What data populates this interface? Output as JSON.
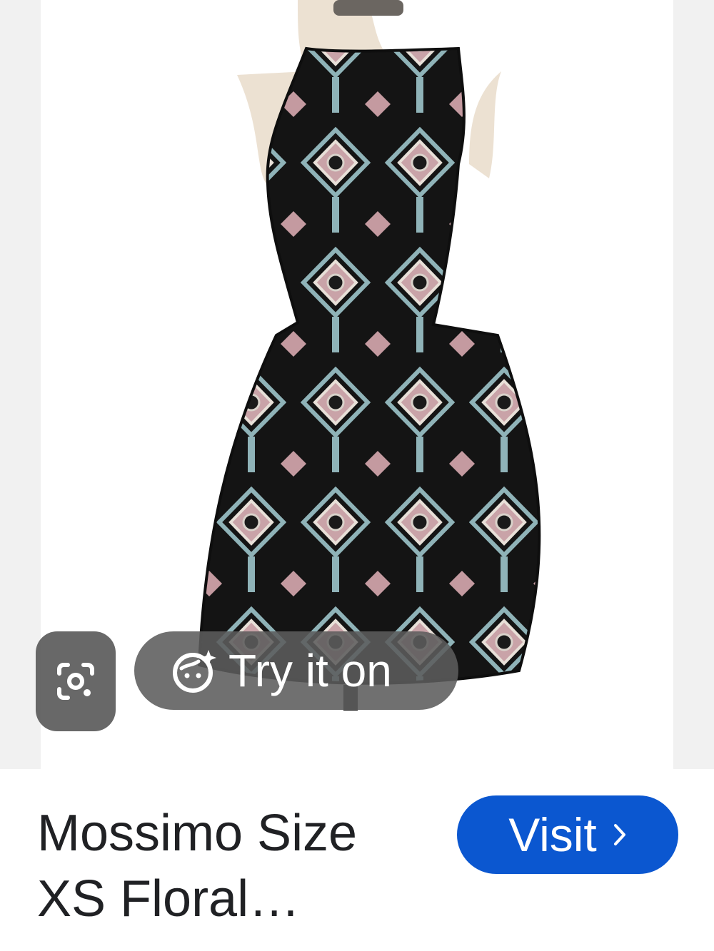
{
  "image_viewer": {
    "lens_icon": "google-lens-icon",
    "try_on": {
      "label": "Try it on",
      "icon": "sparkle-face-icon"
    }
  },
  "product": {
    "title": "Mossimo Size XS Floral…"
  },
  "actions": {
    "visit_label": "Visit",
    "visit_icon": "chevron-right-icon",
    "visit_color": "#0b57d0"
  }
}
